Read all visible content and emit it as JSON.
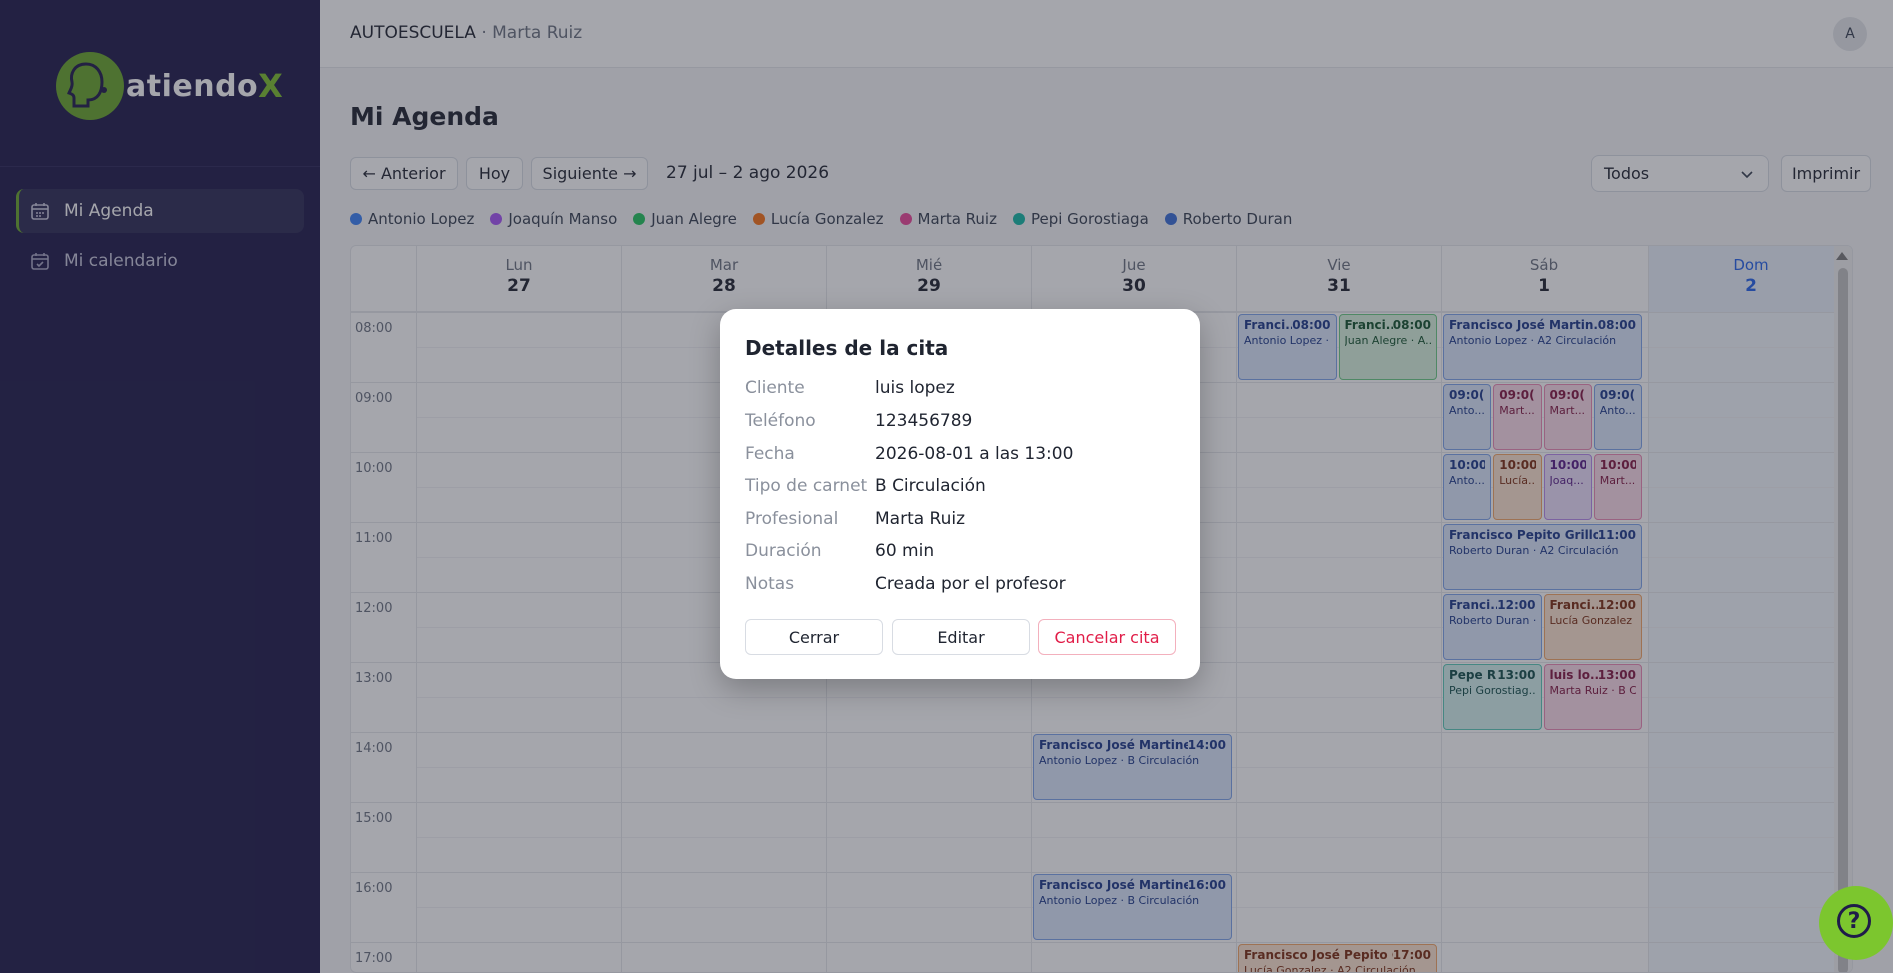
{
  "brand": {
    "name": "atiendo",
    "x": "X"
  },
  "sidebar": {
    "items": [
      {
        "label": "Mi Agenda",
        "active": true,
        "icon": "calendar-icon"
      },
      {
        "label": "Mi calendario",
        "active": false,
        "icon": "calendar-check-icon"
      }
    ]
  },
  "topbar": {
    "org": "AUTOESCUELA",
    "user": "· Marta Ruiz",
    "avatar": "A"
  },
  "page": {
    "title": "Mi Agenda"
  },
  "toolbar": {
    "prev": "← Anterior",
    "today": "Hoy",
    "next": "Siguiente →",
    "range": "27 jul – 2 ago 2026",
    "filter": "Todos",
    "print": "Imprimir"
  },
  "legend": [
    {
      "name": "Antonio Lopez",
      "color": "#3b82f6"
    },
    {
      "name": "Joaquín Manso",
      "color": "#a855f7"
    },
    {
      "name": "Juan Alegre",
      "color": "#22c55e"
    },
    {
      "name": "Lucía Gonzalez",
      "color": "#f97316"
    },
    {
      "name": "Marta Ruiz",
      "color": "#ec4899"
    },
    {
      "name": "Pepi Gorostiaga",
      "color": "#14b8a6"
    },
    {
      "name": "Roberto Duran",
      "color": "#3b6fd8"
    }
  ],
  "calendar": {
    "days": [
      {
        "name": "Lun",
        "num": "27"
      },
      {
        "name": "Mar",
        "num": "28"
      },
      {
        "name": "Mié",
        "num": "29"
      },
      {
        "name": "Jue",
        "num": "30"
      },
      {
        "name": "Vie",
        "num": "31"
      },
      {
        "name": "Sáb",
        "num": "1"
      },
      {
        "name": "Dom",
        "num": "2"
      }
    ],
    "hours": [
      "08:00",
      "09:00",
      "10:00",
      "11:00",
      "12:00",
      "13:00",
      "14:00",
      "15:00",
      "16:00",
      "17:00"
    ],
    "events": [
      {
        "title": "Franci...",
        "time": "08:00",
        "sub": "Antonio Lopez · ...",
        "color": "blue"
      },
      {
        "title": "Franci...",
        "time": "08:00",
        "sub": "Juan Alegre · A...",
        "color": "green"
      },
      {
        "title": "Francisco José Martin...",
        "time": "08:00",
        "sub": "Antonio Lopez · A2 Circulación",
        "color": "blue"
      },
      {
        "title": "Francisco Pepito Grillo",
        "time": "11:00",
        "sub": "Roberto Duran · A2 Circulación",
        "color": "blue"
      },
      {
        "title": "Franci...",
        "time": "12:00",
        "sub": "Roberto Duran · ...",
        "color": "blue"
      },
      {
        "title": "Franci...",
        "time": "12:00",
        "sub": "Lucía Gonzalez ...",
        "color": "orange"
      },
      {
        "title": "Pepe R...",
        "time": "13:00",
        "sub": "Pepi Gorostiag...",
        "color": "teal"
      },
      {
        "title": "luis lo...",
        "time": "13:00",
        "sub": "Marta Ruiz · B C...",
        "color": "pink"
      },
      {
        "title": "Francisco José Martine...",
        "time": "14:00",
        "sub": "Antonio Lopez · B Circulación",
        "color": "blue"
      },
      {
        "title": "Francisco José Martine...",
        "time": "16:00",
        "sub": "Antonio Lopez · B Circulación",
        "color": "blue"
      },
      {
        "title": "Francisco José Pepito G...",
        "time": "17:00",
        "sub": "Lucía Gonzalez · A2 Circulación",
        "color": "orange"
      },
      {
        "title": "09:0(",
        "time": "",
        "sub": "Anto...",
        "color": "blue"
      },
      {
        "title": "09:0(",
        "time": "",
        "sub": "Mart...",
        "color": "pink"
      },
      {
        "title": "09:0(",
        "time": "",
        "sub": "Mart...",
        "color": "pink"
      },
      {
        "title": "09:0(",
        "time": "",
        "sub": "Anto...",
        "color": "blue"
      },
      {
        "title": "10:00",
        "time": "",
        "sub": "Anto...",
        "color": "blue"
      },
      {
        "title": "10:00",
        "time": "",
        "sub": "Lucía...",
        "color": "orange"
      },
      {
        "title": "10:00",
        "time": "",
        "sub": "Joaq...",
        "color": "purple"
      },
      {
        "title": "10:00",
        "time": "",
        "sub": "Mart...",
        "color": "pink"
      }
    ]
  },
  "modal": {
    "title": "Detalles de la cita",
    "rows": [
      {
        "label": "Cliente",
        "value": "luis lopez"
      },
      {
        "label": "Teléfono",
        "value": "123456789"
      },
      {
        "label": "Fecha",
        "value": "2026-08-01 a las 13:00"
      },
      {
        "label": "Tipo de carnet",
        "value": "B Circulación"
      },
      {
        "label": "Profesional",
        "value": "Marta Ruiz"
      },
      {
        "label": "Duración",
        "value": "60 min"
      },
      {
        "label": "Notas",
        "value": "Creada por el profesor"
      }
    ],
    "close": "Cerrar",
    "edit": "Editar",
    "cancel": "Cancelar cita"
  }
}
